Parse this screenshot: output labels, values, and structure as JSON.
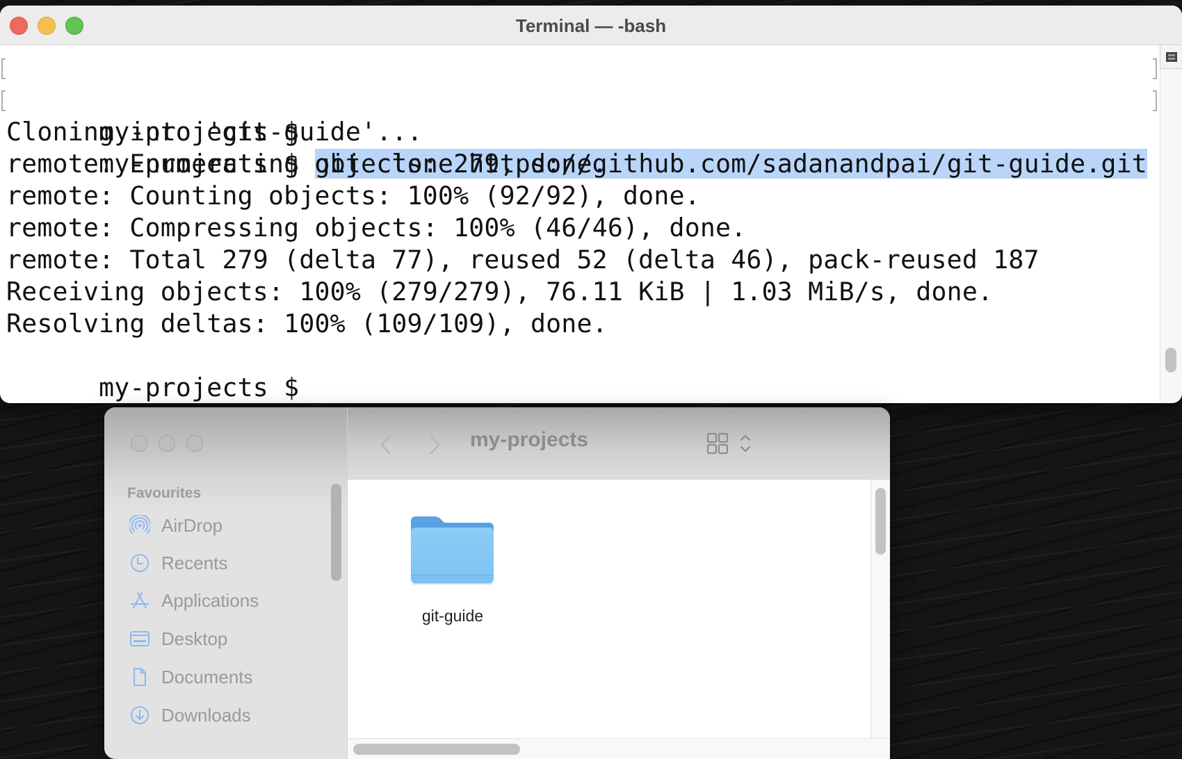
{
  "terminal": {
    "title": "Terminal — -bash",
    "prompt": "my-projects $",
    "lines": [
      {
        "prompt": "my-projects $",
        "text": "",
        "marked": true,
        "selected": ""
      },
      {
        "prompt": "my-projects $",
        "text": " ",
        "marked": true,
        "selected": "git clone https://github.com/sadanandpai/git-guide.git"
      },
      {
        "prompt": "",
        "text": "Cloning into 'git-guide'...",
        "marked": false,
        "selected": ""
      },
      {
        "prompt": "",
        "text": "remote: Enumerating objects: 279, done.",
        "marked": false,
        "selected": ""
      },
      {
        "prompt": "",
        "text": "remote: Counting objects: 100% (92/92), done.",
        "marked": false,
        "selected": ""
      },
      {
        "prompt": "",
        "text": "remote: Compressing objects: 100% (46/46), done.",
        "marked": false,
        "selected": ""
      },
      {
        "prompt": "",
        "text": "remote: Total 279 (delta 77), reused 52 (delta 46), pack-reused 187",
        "marked": false,
        "selected": ""
      },
      {
        "prompt": "",
        "text": "Receiving objects: 100% (279/279), 76.11 KiB | 1.03 MiB/s, done.",
        "marked": false,
        "selected": ""
      },
      {
        "prompt": "",
        "text": "Resolving deltas: 100% (109/109), done.",
        "marked": false,
        "selected": ""
      },
      {
        "prompt": "my-projects $",
        "text": "",
        "marked": false,
        "selected": ""
      }
    ],
    "selection_color": "#b9d5f9",
    "traffic_lights": {
      "close": "#ee6a5e",
      "minimize": "#f5bf4f",
      "maximize": "#61c454"
    }
  },
  "finder": {
    "title": "my-projects",
    "sidebar": {
      "heading": "Favourites",
      "items": [
        {
          "label": "AirDrop",
          "icon": "airdrop-icon"
        },
        {
          "label": "Recents",
          "icon": "clock-icon"
        },
        {
          "label": "Applications",
          "icon": "applications-icon"
        },
        {
          "label": "Desktop",
          "icon": "desktop-icon"
        },
        {
          "label": "Documents",
          "icon": "document-icon"
        },
        {
          "label": "Downloads",
          "icon": "download-icon"
        }
      ]
    },
    "items": [
      {
        "name": "git-guide",
        "type": "folder",
        "icon": "folder-icon"
      }
    ],
    "accent_color": "#8fb8ef"
  }
}
